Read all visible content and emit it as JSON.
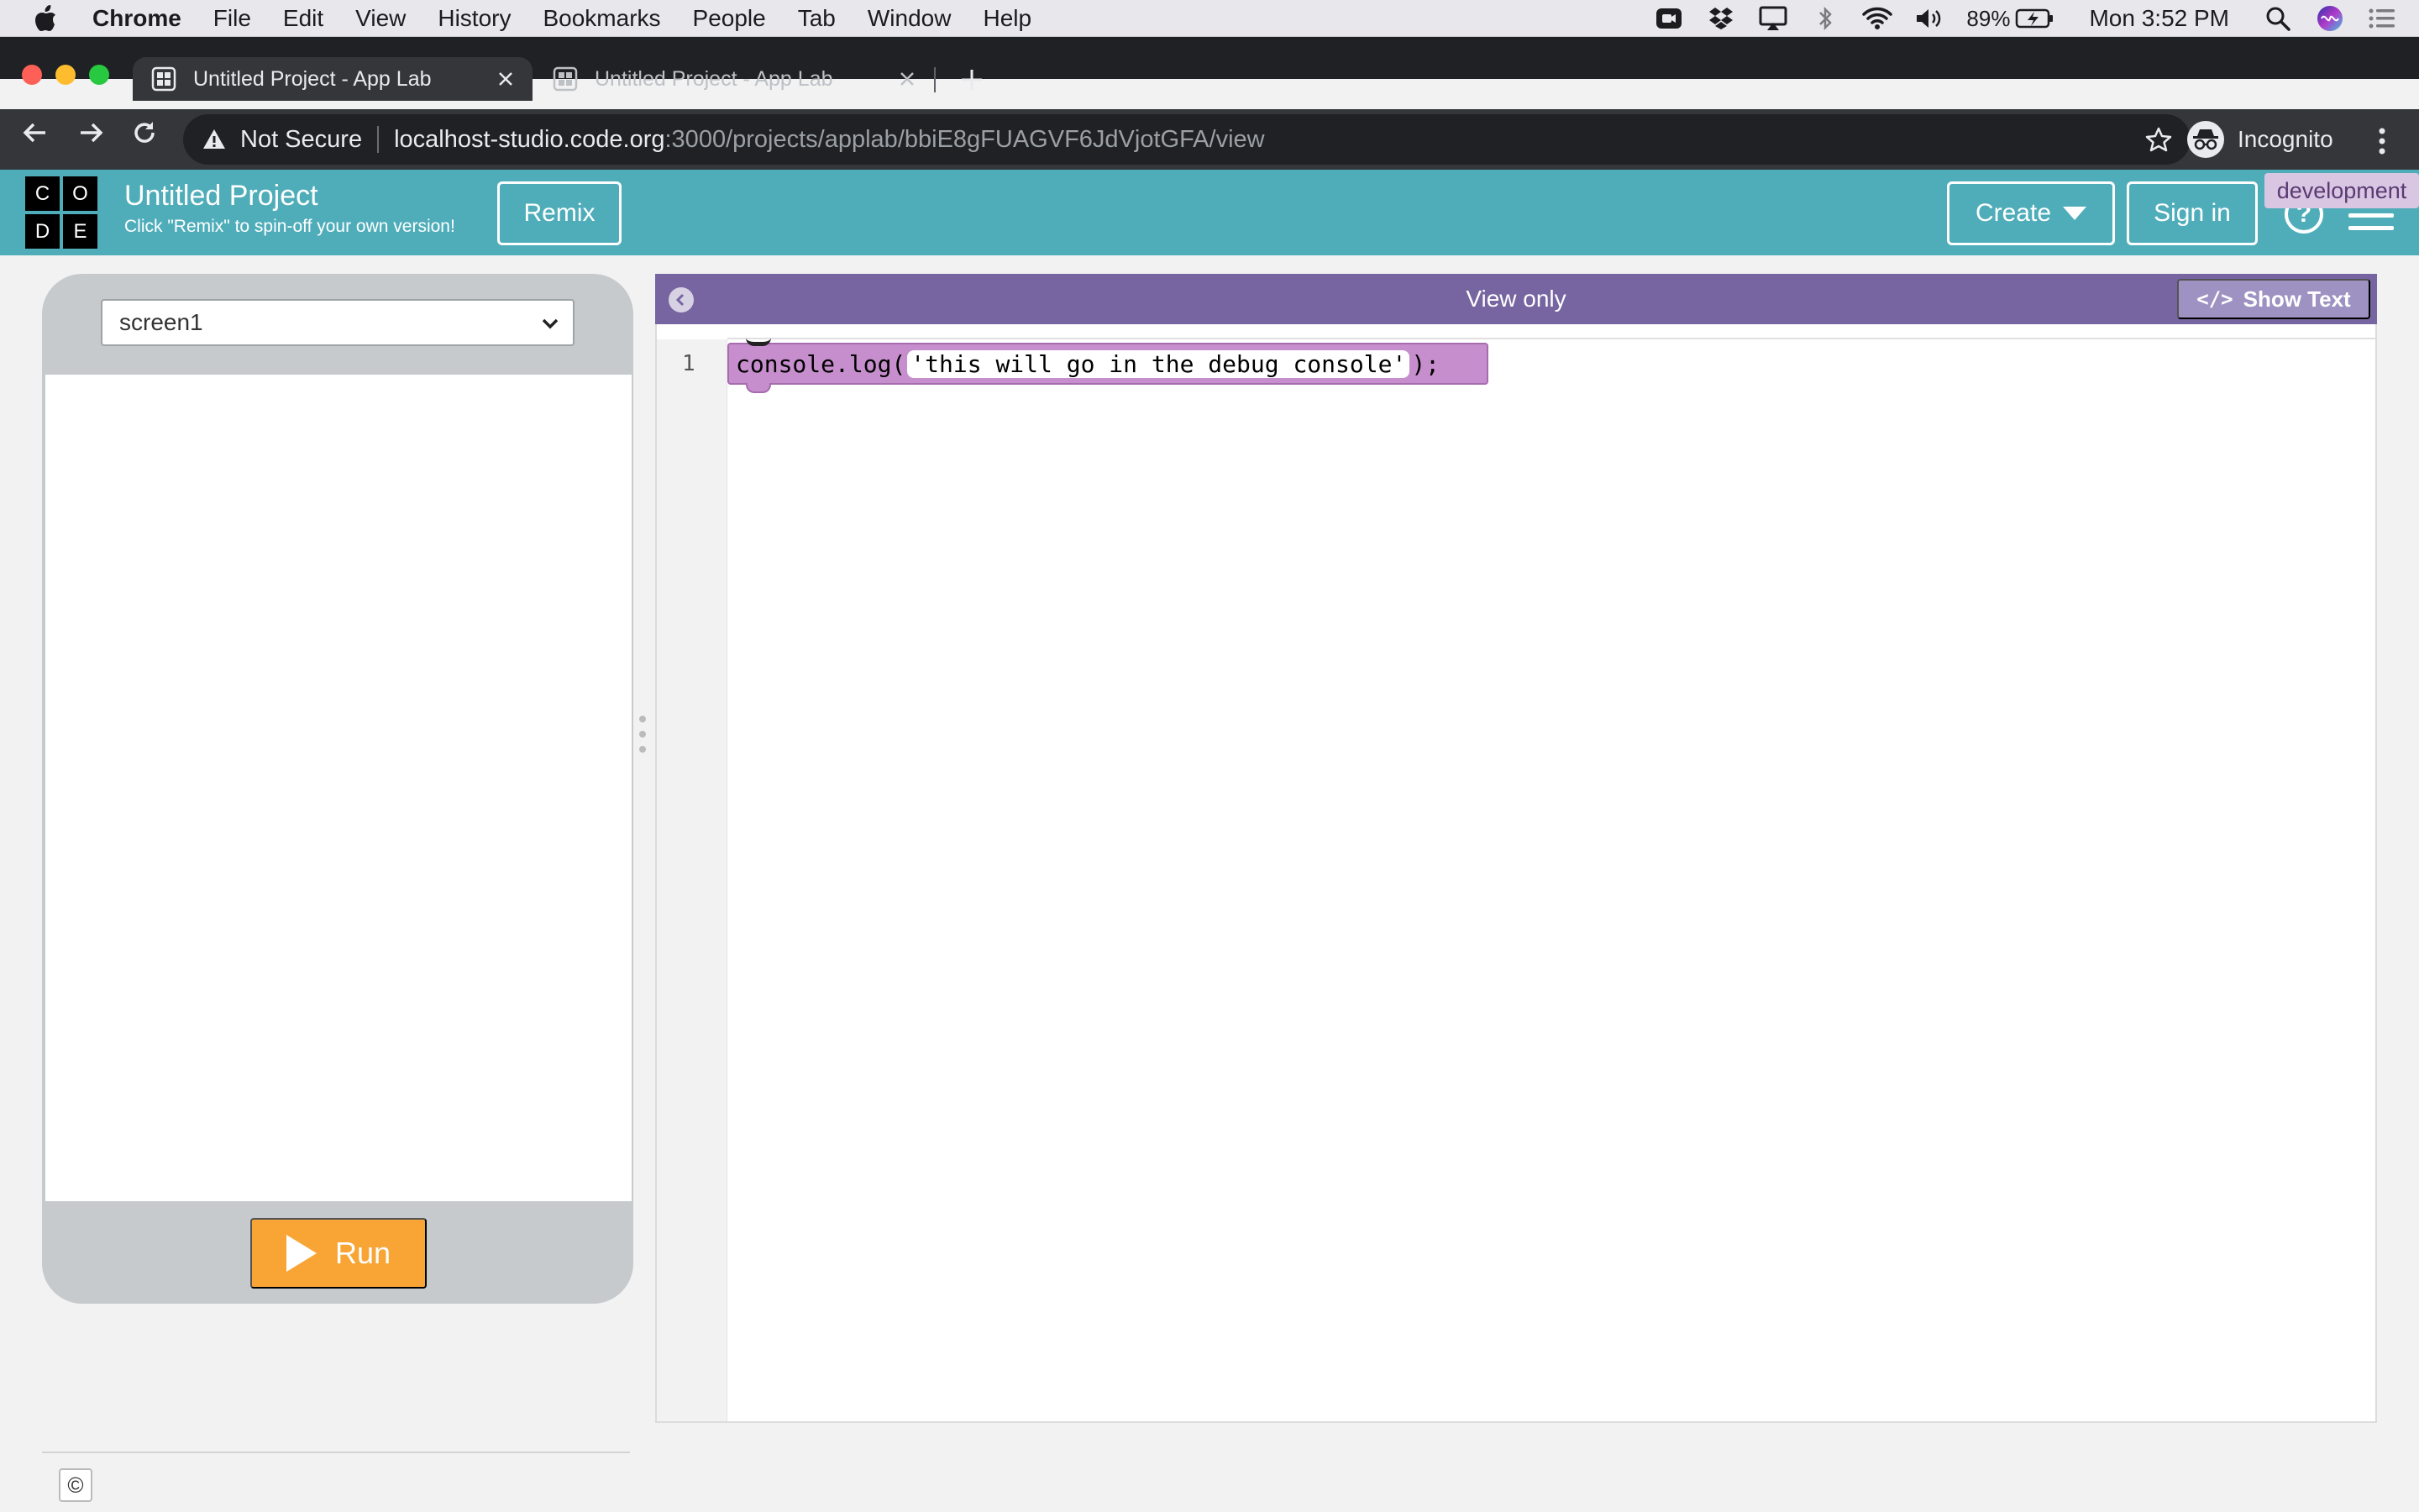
{
  "menubar": {
    "app": "Chrome",
    "items": [
      "File",
      "Edit",
      "View",
      "History",
      "Bookmarks",
      "People",
      "Tab",
      "Window",
      "Help"
    ],
    "battery": "89%",
    "clock": "Mon 3:52 PM"
  },
  "tabs": [
    {
      "title": "Untitled Project - App Lab",
      "active": true
    },
    {
      "title": "Untitled Project - App Lab",
      "active": false
    }
  ],
  "omnibox": {
    "security": "Not Secure",
    "host": "localhost-studio.code.org",
    "path": ":3000/projects/applab/bbiE8gFUAGVF6JdVjotGFA/view"
  },
  "profile": {
    "label": "Incognito"
  },
  "header": {
    "logo_letters": [
      "C",
      "O",
      "D",
      "E"
    ],
    "project_title": "Untitled Project",
    "subtitle": "Click \"Remix\" to spin-off your own version!",
    "remix": "Remix",
    "create": "Create",
    "sign_in": "Sign in",
    "env_badge": "development",
    "help": "?"
  },
  "preview": {
    "screen_selected": "screen1",
    "run": "Run"
  },
  "workspace": {
    "title": "View only",
    "show_text": "Show Text",
    "code_icon": "</>",
    "line_number": "1",
    "code_prefix": "console.log(",
    "code_arg": "'this will go in the debug console'",
    "code_suffix": ");"
  },
  "footer": {
    "copyright": "©"
  },
  "colors": {
    "header_teal": "#4fadba",
    "workspace_purple": "#7665a0",
    "block_purple": "#c68ecd",
    "run_orange": "#f8a536"
  }
}
